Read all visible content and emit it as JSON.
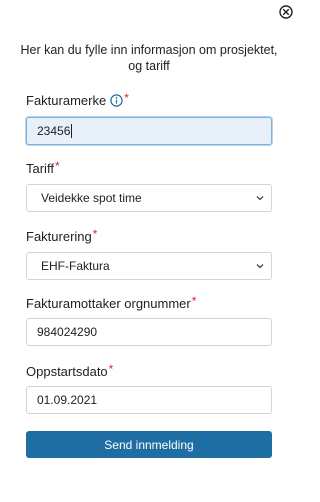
{
  "dialog": {
    "intro_line1": "Her kan du fylle inn informasjon om prosjektet,",
    "intro_line2": "og tariff"
  },
  "fields": {
    "fakturamerke": {
      "label": "Fakturamerke",
      "required_mark": "*",
      "value": "23456"
    },
    "tariff": {
      "label": "Tariff",
      "required_mark": "*",
      "selected": "Veidekke spot time"
    },
    "fakturering": {
      "label": "Fakturering",
      "required_mark": "*",
      "selected": "EHF-Faktura"
    },
    "orgnummer": {
      "label": "Fakturamottaker orgnummer",
      "required_mark": "*",
      "value": "984024290"
    },
    "oppstartsdato": {
      "label": "Oppstartsdato",
      "required_mark": "*",
      "value": "01.09.2021"
    }
  },
  "submit": {
    "label": "Send innmelding"
  },
  "colors": {
    "accent": "#1f6ea3",
    "required": "#e0252d",
    "focus_bg": "#e8f0fa",
    "border": "#d4d4d4"
  },
  "icons": {
    "close": "close-circle-icon",
    "info": "info-circle-icon",
    "dropdown": "chevron-down-icon"
  }
}
